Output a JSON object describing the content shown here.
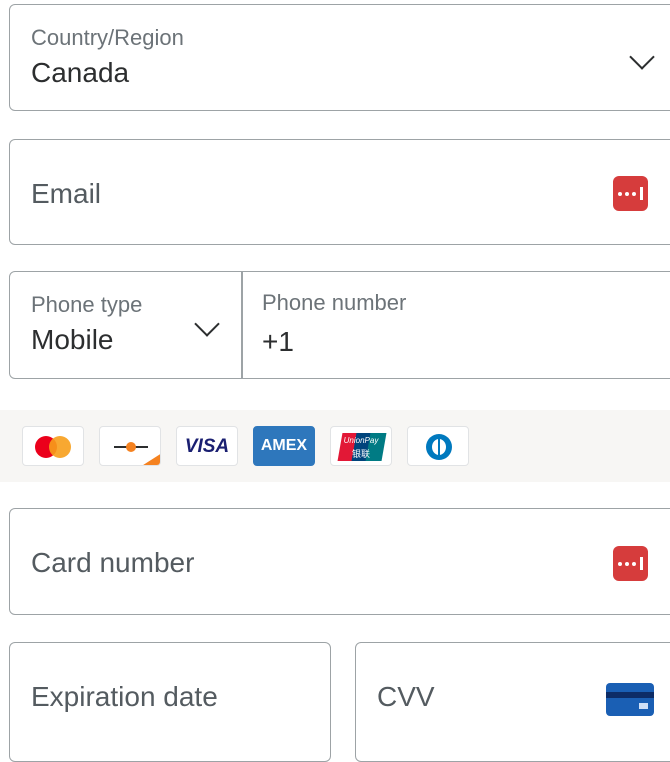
{
  "country": {
    "label": "Country/Region",
    "value": "Canada"
  },
  "email": {
    "placeholder": "Email"
  },
  "phone": {
    "type_label": "Phone type",
    "type_value": "Mobile",
    "number_label": "Phone number",
    "number_value": "+1"
  },
  "brands": [
    "mastercard-icon",
    "discover-icon",
    "visa-icon",
    "amex-icon",
    "unionpay-icon",
    "diners-club-icon"
  ],
  "brand_text": {
    "visa": "VISA",
    "amex": "AMEX",
    "unionpay": "UnionPay",
    "unionpay_cn": "银联"
  },
  "card": {
    "placeholder": "Card number"
  },
  "expiration": {
    "placeholder": "Expiration date"
  },
  "cvv": {
    "placeholder": "CVV"
  },
  "colors": {
    "autofill": "#d63c3c",
    "border": "#9da3a6",
    "strip": "#f7f6f4",
    "amex": "#2e77bc",
    "visa": "#1a1f71"
  }
}
